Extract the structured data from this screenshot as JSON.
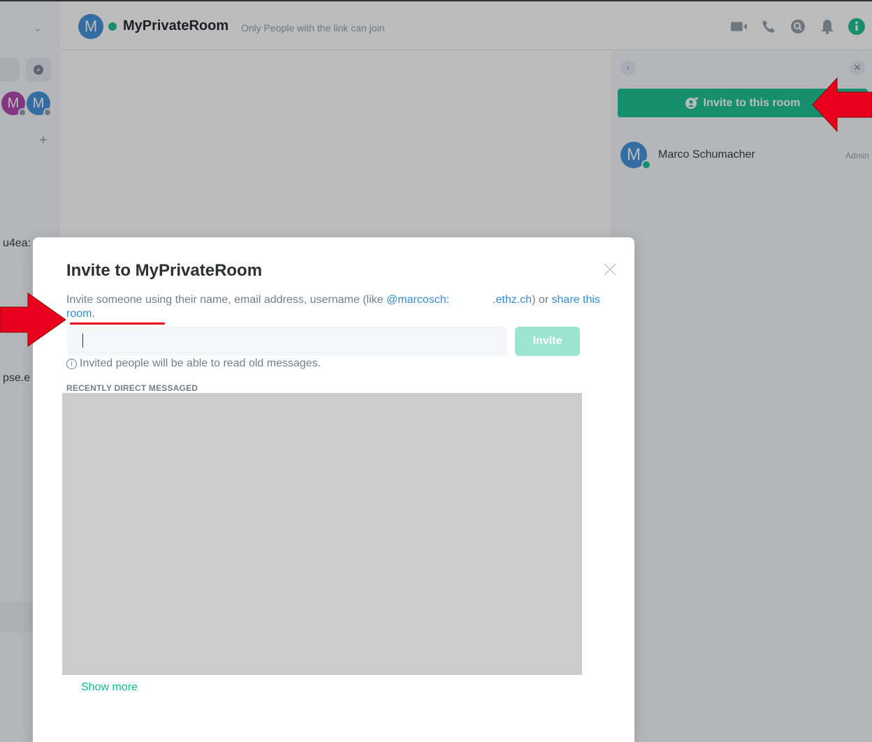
{
  "room": {
    "avatar_letter": "M",
    "name": "MyPrivateRoom",
    "topic": "Only People with the link can join"
  },
  "header_icons": [
    "video-call-icon",
    "voice-call-icon",
    "search-icon",
    "notifications-bell-icon",
    "room-info-icon"
  ],
  "left_panel": {
    "avatars": [
      {
        "letter": "M",
        "color": "#ac3ba8"
      },
      {
        "letter": "M",
        "color": "#368bd6"
      }
    ],
    "add_label": "+",
    "truncated_text_1": "u4ea:",
    "truncated_text_2": "pse.e"
  },
  "right_panel": {
    "invite_button_label": "Invite to this room",
    "member": {
      "avatar_letter": "M",
      "name": "Marco Schumacher",
      "role": "Admin"
    }
  },
  "dialog": {
    "title": "Invite to MyPrivateRoom",
    "desc_prefix": "Invite someone using their name, email address, username (like ",
    "desc_user_link": "@marcosch:",
    "desc_domain_link": ".ethz.ch",
    "desc_suffix": ") or ",
    "share_link": "share this room.",
    "search_value": "",
    "invite_button_label": "Invite",
    "hint": "Invited people will be able to read old messages.",
    "section_title": "RECENTLY DIRECT MESSAGED",
    "show_more_label": "Show more"
  },
  "colors": {
    "accent": "#0dbd8b",
    "link": "#368bd6",
    "annotation_red": "#e8001c"
  }
}
